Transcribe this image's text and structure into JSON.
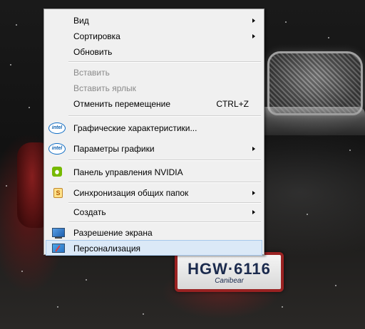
{
  "wallpaper": {
    "license_plate_number": "HGW·6116",
    "license_plate_subtext": "Canibear"
  },
  "context_menu": {
    "items": [
      {
        "label": "Вид",
        "submenu": true,
        "disabled": false
      },
      {
        "label": "Сортировка",
        "submenu": true,
        "disabled": false
      },
      {
        "label": "Обновить",
        "submenu": false,
        "disabled": false
      },
      {
        "label": "Вставить",
        "submenu": false,
        "disabled": true
      },
      {
        "label": "Вставить ярлык",
        "submenu": false,
        "disabled": true
      },
      {
        "label": "Отменить перемещение",
        "shortcut": "CTRL+Z",
        "submenu": false,
        "disabled": false
      },
      {
        "label": "Графические характеристики...",
        "icon": "intel-icon",
        "icon_text": "intel",
        "submenu": false,
        "disabled": false
      },
      {
        "label": "Параметры графики",
        "icon": "intel-icon",
        "icon_text": "intel",
        "submenu": true,
        "disabled": false
      },
      {
        "label": "Панель управления NVIDIA",
        "icon": "nvidia-icon",
        "submenu": false,
        "disabled": false
      },
      {
        "label": "Синхронизация общих папок",
        "icon": "sync-icon",
        "icon_text": "S",
        "submenu": true,
        "disabled": false
      },
      {
        "label": "Создать",
        "submenu": true,
        "disabled": false
      },
      {
        "label": "Разрешение экрана",
        "icon": "monitor-icon",
        "submenu": false,
        "disabled": false
      },
      {
        "label": "Персонализация",
        "icon": "personalize-icon",
        "submenu": false,
        "disabled": false,
        "highlighted": true
      }
    ]
  },
  "colors": {
    "menu_background": "#f0f0f0",
    "highlight_background": "#dbe9f7",
    "highlight_border": "#a6c8ec",
    "disabled_text": "#8a8a8a"
  }
}
